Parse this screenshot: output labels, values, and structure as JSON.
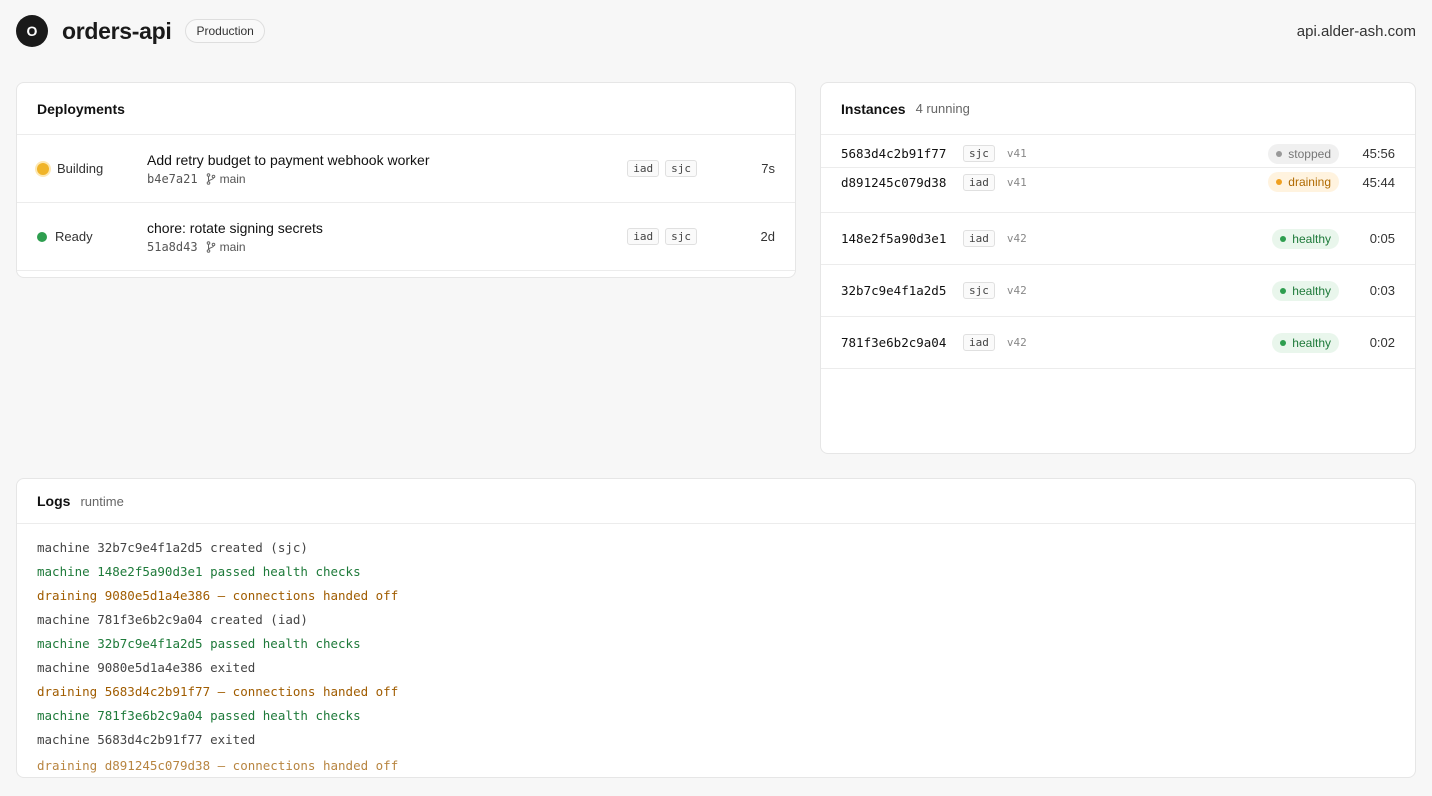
{
  "header": {
    "logo_letter": "O",
    "app_name": "orders-api",
    "environment": "Production",
    "domain": "api.alder-ash.com"
  },
  "deployments": {
    "title": "Deployments",
    "rows": [
      {
        "status": "Building",
        "message": "Add retry budget to payment webhook worker",
        "commit": "b4e7a21",
        "branch": "main",
        "regions": [
          "iad",
          "sjc"
        ],
        "age": "7s"
      },
      {
        "status": "Ready",
        "message": "chore: rotate signing secrets",
        "commit": "51a8d43",
        "branch": "main",
        "regions": [
          "iad",
          "sjc"
        ],
        "age": "2d"
      }
    ]
  },
  "instances": {
    "title": "Instances",
    "summary": "4 running",
    "rows": [
      {
        "id": "5683d4c2b91f77",
        "region": "sjc",
        "version": "v41",
        "state": "stopped",
        "uptime": "45:56"
      },
      {
        "id": "d891245c079d38",
        "region": "iad",
        "version": "v41",
        "state": "draining",
        "uptime": "45:44"
      },
      {
        "id": "148e2f5a90d3e1",
        "region": "iad",
        "version": "v42",
        "state": "healthy",
        "uptime": "0:05"
      },
      {
        "id": "32b7c9e4f1a2d5",
        "region": "sjc",
        "version": "v42",
        "state": "healthy",
        "uptime": "0:03"
      },
      {
        "id": "781f3e6b2c9a04",
        "region": "iad",
        "version": "v42",
        "state": "healthy",
        "uptime": "0:02"
      }
    ]
  },
  "logs": {
    "title": "Logs",
    "source": "runtime",
    "lines": [
      "machine 32b7c9e4f1a2d5 created (sjc)",
      "machine 148e2f5a90d3e1 passed health checks",
      "draining 9080e5d1a4e386 — connections handed off",
      "machine 781f3e6b2c9a04 created (iad)",
      "machine 32b7c9e4f1a2d5 passed health checks",
      "machine 9080e5d1a4e386 exited",
      "draining 5683d4c2b91f77 — connections handed off",
      "machine 781f3e6b2c9a04 passed health checks",
      "machine 5683d4c2b91f77 exited",
      "draining d891245c079d38 — connections handed off"
    ]
  },
  "colors": {
    "building": "#f0b429",
    "ready": "#2e9e4f",
    "healthy": "#2e9e4f",
    "draining": "#f0a020",
    "stopped": "#999999",
    "log_ok": "#1e7a3a",
    "log_warn": "#a05c00"
  },
  "icons": {
    "branch": "git-branch-icon",
    "status": "status-dot-icon"
  }
}
